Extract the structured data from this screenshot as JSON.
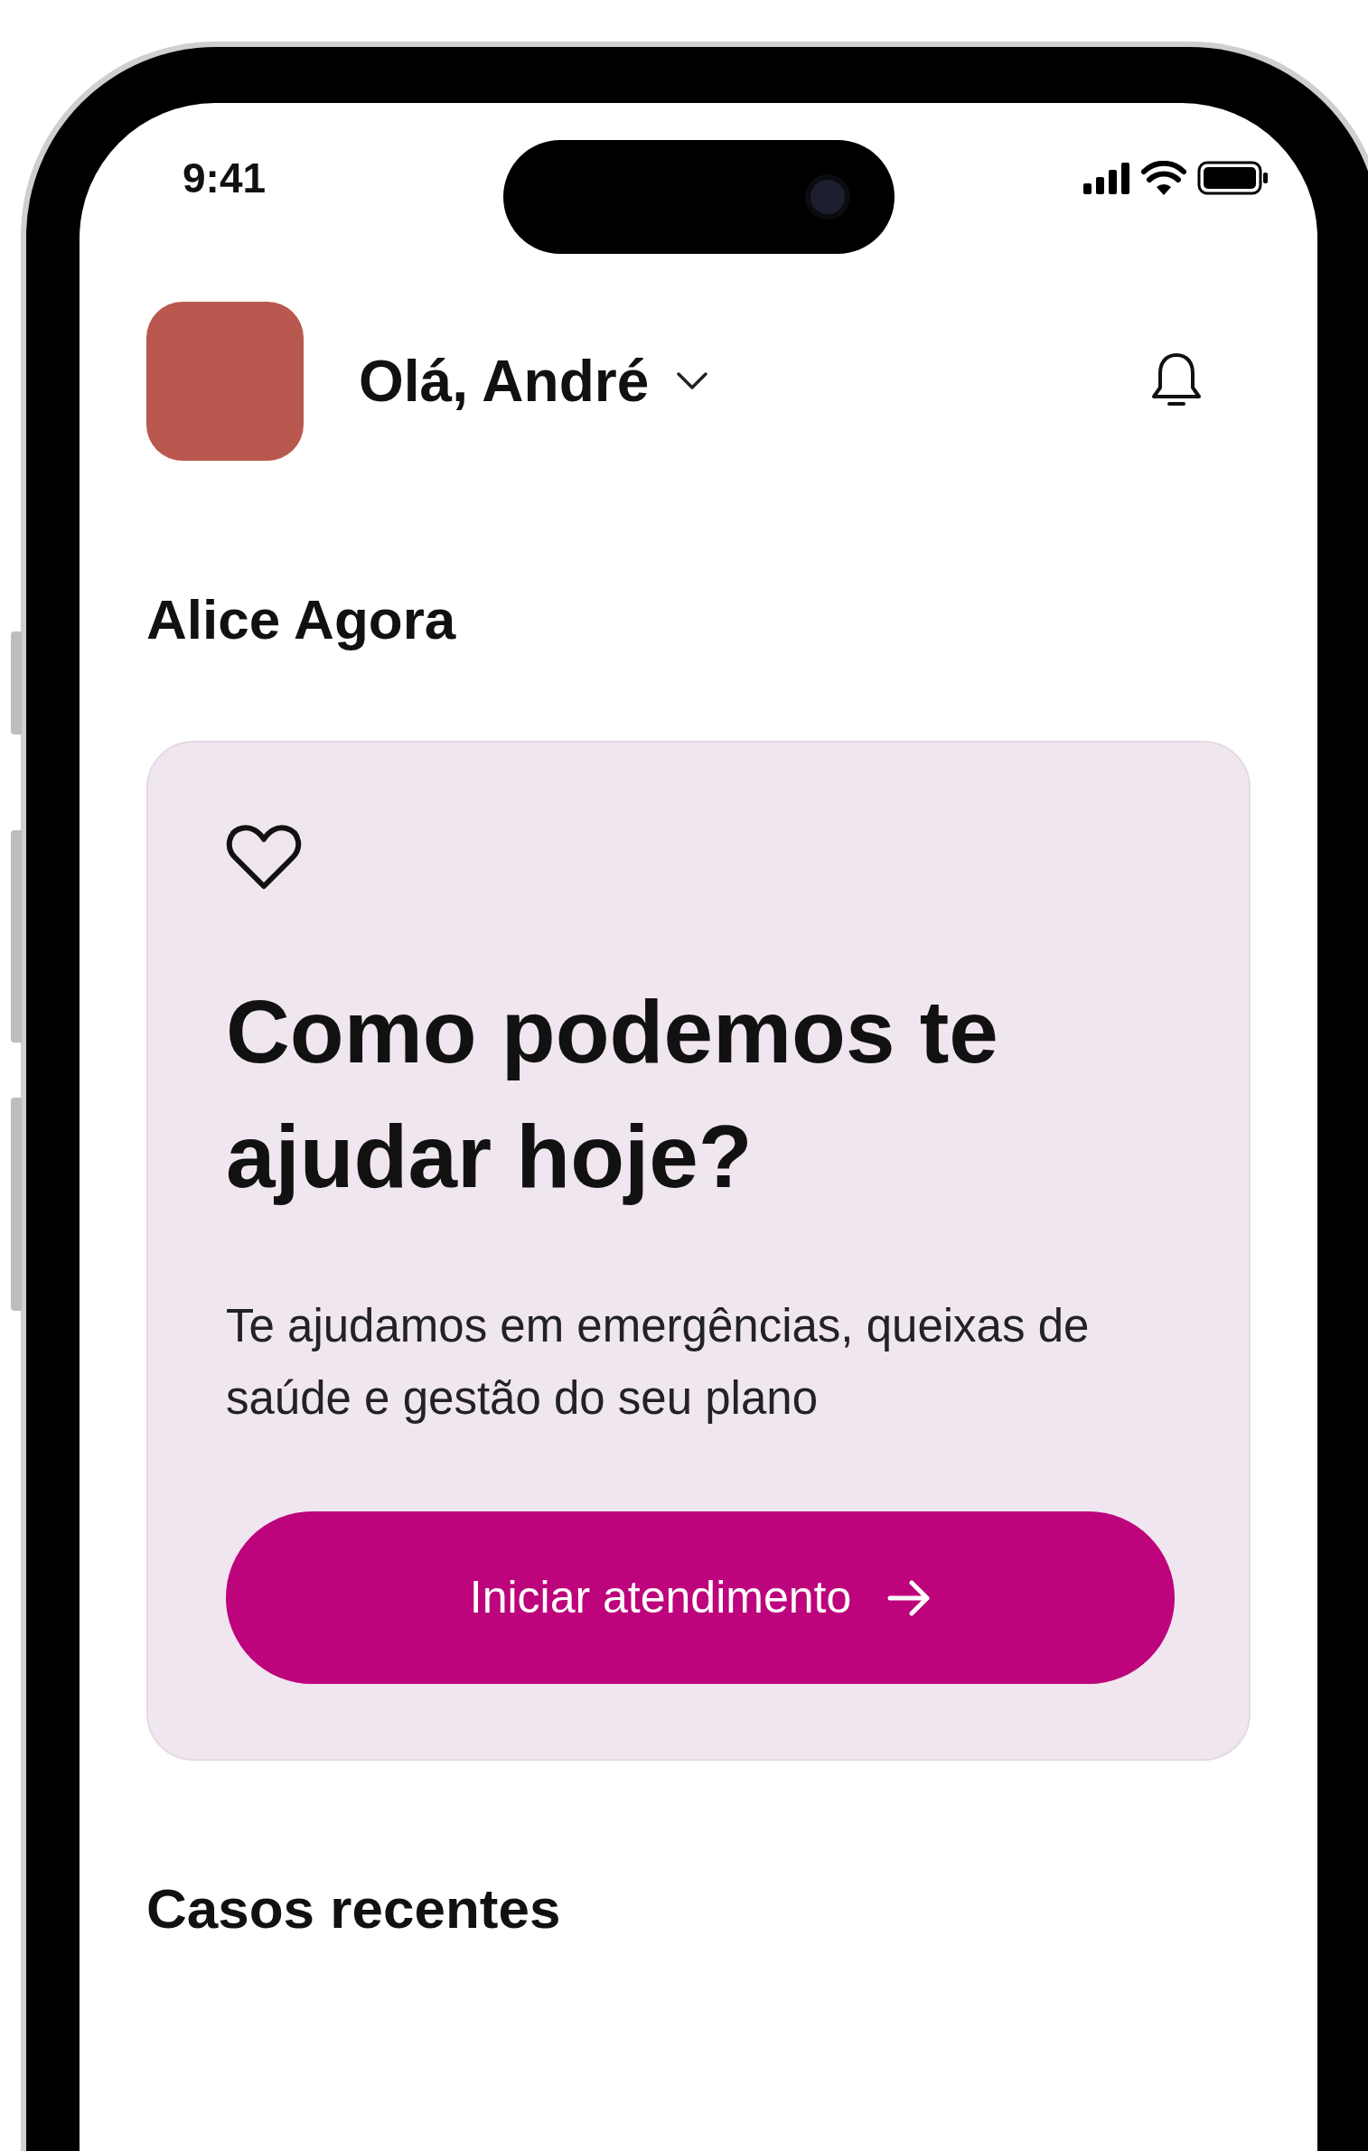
{
  "status_bar": {
    "time": "9:41"
  },
  "header": {
    "greeting": "Olá, André"
  },
  "section_title": "Alice Agora",
  "help_card": {
    "title": "Como podemos te ajudar hoje?",
    "description": "Te ajudamos em emergências, queixas de saúde e gestão do seu plano",
    "button": "Iniciar atendimento"
  },
  "recent_section_title": "Casos recentes"
}
